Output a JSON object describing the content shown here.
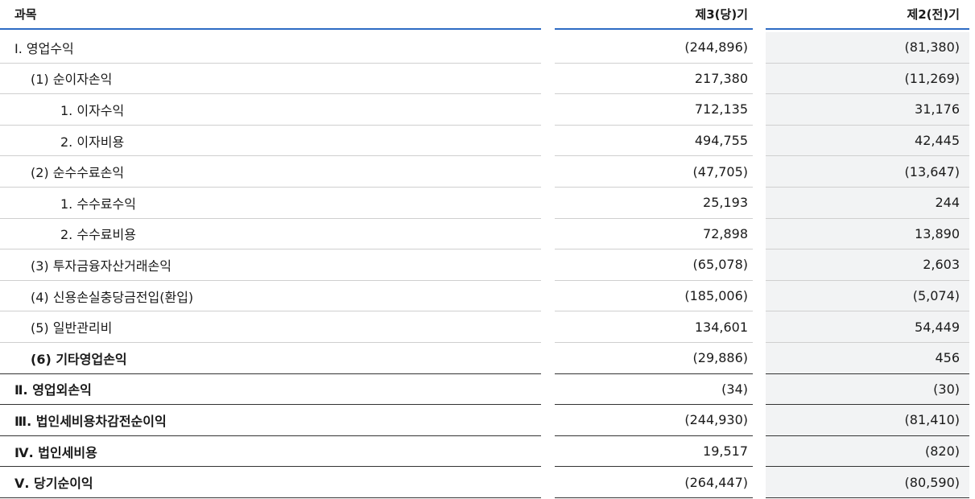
{
  "header": {
    "subject": "과목",
    "current": "제3(당)기",
    "previous": "제2(전)기"
  },
  "rows": [
    {
      "label": "Ⅰ. 영업수익",
      "current": "(244,896)",
      "previous": "(81,380)",
      "level": 0,
      "major": false
    },
    {
      "label": "(1) 순이자손익",
      "current": "217,380",
      "previous": "(11,269)",
      "level": 1,
      "major": false
    },
    {
      "label": "1. 이자수익",
      "current": "712,135",
      "previous": "31,176",
      "level": 2,
      "major": false
    },
    {
      "label": "2. 이자비용",
      "current": "494,755",
      "previous": "42,445",
      "level": 2,
      "major": false
    },
    {
      "label": "(2) 순수수료손익",
      "current": "(47,705)",
      "previous": "(13,647)",
      "level": 1,
      "major": false
    },
    {
      "label": "1. 수수료수익",
      "current": "25,193",
      "previous": "244",
      "level": 2,
      "major": false
    },
    {
      "label": "2. 수수료비용",
      "current": "72,898",
      "previous": "13,890",
      "level": 2,
      "major": false
    },
    {
      "label": "(3) 투자금융자산거래손익",
      "current": "(65,078)",
      "previous": "2,603",
      "level": 1,
      "major": false
    },
    {
      "label": "(4) 신용손실충당금전입(환입)",
      "current": "(185,006)",
      "previous": "(5,074)",
      "level": 1,
      "major": false
    },
    {
      "label": "(5) 일반관리비",
      "current": "134,601",
      "previous": "54,449",
      "level": 1,
      "major": false
    },
    {
      "label": "(6) 기타영업손익",
      "current": "(29,886)",
      "previous": "456",
      "level": 1,
      "major": true
    },
    {
      "label": "Ⅱ. 영업외손익",
      "current": "(34)",
      "previous": "(30)",
      "level": 0,
      "major": true
    },
    {
      "label": "Ⅲ. 법인세비용차감전순이익",
      "current": "(244,930)",
      "previous": "(81,410)",
      "level": 0,
      "major": true
    },
    {
      "label": "Ⅳ. 법인세비용",
      "current": "19,517",
      "previous": "(820)",
      "level": 0,
      "major": true
    },
    {
      "label": "Ⅴ. 당기순이익",
      "current": "(264,447)",
      "previous": "(80,590)",
      "level": 0,
      "major": true
    }
  ]
}
